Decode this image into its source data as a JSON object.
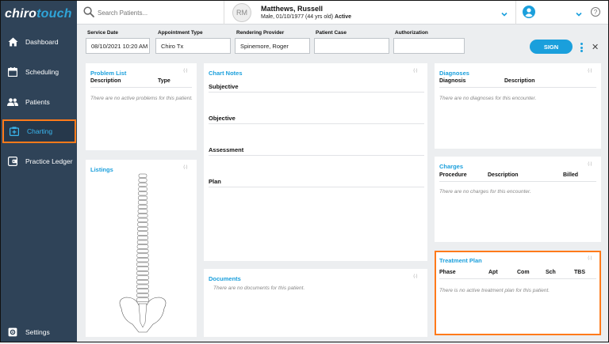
{
  "app": {
    "logo_part1": "chiro",
    "logo_part2": "touch"
  },
  "sidebar": {
    "items": [
      {
        "label": "Dashboard",
        "icon": "home-icon"
      },
      {
        "label": "Scheduling",
        "icon": "calendar-icon"
      },
      {
        "label": "Patients",
        "icon": "users-icon"
      },
      {
        "label": "Charting",
        "icon": "chart-add-icon"
      },
      {
        "label": "Practice Ledger",
        "icon": "wallet-icon"
      },
      {
        "label": "Settings",
        "icon": "gear-icon"
      }
    ],
    "active": "Charting"
  },
  "header": {
    "search_placeholder": "Search Patients...",
    "avatar_initials": "RM",
    "patient_name": "Matthews, Russell",
    "patient_info": "Male, 01/10/1977 (44 yrs old)",
    "patient_status": "Active",
    "help": "?"
  },
  "encounter": {
    "service_date_label": "Service Date",
    "service_date": "08/10/2021 10:20 AM",
    "appointment_type_label": "Appointment Type",
    "appointment_type": "Chiro Tx",
    "rendering_provider_label": "Rendering Provider",
    "rendering_provider": "Spinemore, Roger",
    "patient_case_label": "Patient Case",
    "patient_case": "",
    "authorization_label": "Authorization",
    "authorization": "",
    "sign_label": "SIGN"
  },
  "problem_list": {
    "title": "Problem List",
    "col_description": "Description",
    "col_type": "Type",
    "empty": "There are no active problems for this patient."
  },
  "listings": {
    "title": "Listings"
  },
  "chart_notes": {
    "title": "Chart Notes",
    "sections": [
      "Subjective",
      "Objective",
      "Assessment",
      "Plan"
    ]
  },
  "documents": {
    "title": "Documents",
    "empty": "There are no documents for this patient."
  },
  "diagnoses": {
    "title": "Diagnoses",
    "col_diagnosis": "Diagnosis",
    "col_description": "Description",
    "empty": "There are no diagnoses for this encounter."
  },
  "charges": {
    "title": "Charges",
    "col_procedure": "Procedure",
    "col_description": "Description",
    "col_billed": "Billed",
    "empty": "There are no charges for this encounter."
  },
  "treatment_plan": {
    "title": "Treatment Plan",
    "col_phase": "Phase",
    "col_apt": "Apt",
    "col_com": "Com",
    "col_sch": "Sch",
    "col_tbs": "TBS",
    "empty": "There is no active treatment plan for this patient."
  },
  "colors": {
    "sidebar": "#2f4358",
    "accent": "#1a9fdc",
    "highlight": "#ff7a1a"
  }
}
